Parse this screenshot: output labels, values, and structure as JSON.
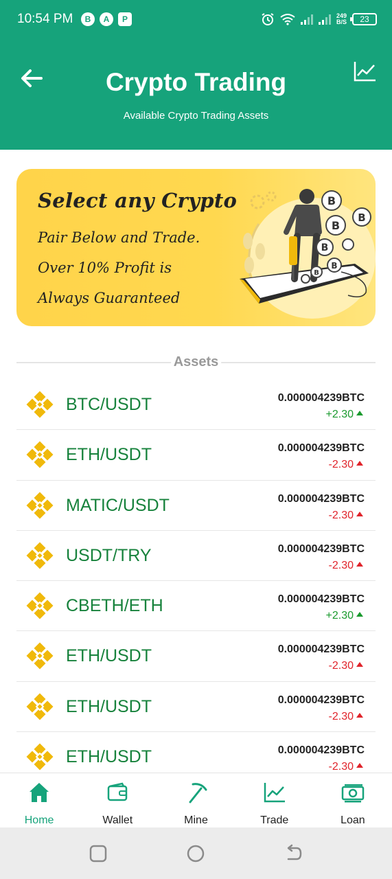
{
  "status_bar": {
    "time": "10:54 PM",
    "notif_icons": [
      "B",
      "A",
      "P"
    ],
    "net_speed_value": "249",
    "net_speed_unit": "B/S",
    "battery": "23"
  },
  "header": {
    "title": "Crypto Trading",
    "subtitle": "Available Crypto Trading Assets",
    "bg_color": "#16a37b"
  },
  "banner": {
    "headline": "Select any Crypto",
    "line1": "Pair Below and Trade.",
    "line2": "Over 10% Profit is",
    "line3": "Always Guaranteed"
  },
  "assets_label": "Assets",
  "assets": [
    {
      "pair": "BTC/USDT",
      "price": "0.000004239BTC",
      "change": "+2.30",
      "direction": "up"
    },
    {
      "pair": "ETH/USDT",
      "price": "0.000004239BTC",
      "change": "-2.30",
      "direction": "down"
    },
    {
      "pair": "MATIC/USDT",
      "price": "0.000004239BTC",
      "change": "-2.30",
      "direction": "down"
    },
    {
      "pair": "USDT/TRY",
      "price": "0.000004239BTC",
      "change": "-2.30",
      "direction": "down"
    },
    {
      "pair": "CBETH/ETH",
      "price": "0.000004239BTC",
      "change": "+2.30",
      "direction": "up"
    },
    {
      "pair": "ETH/USDT",
      "price": "0.000004239BTC",
      "change": "-2.30",
      "direction": "down"
    },
    {
      "pair": "ETH/USDT",
      "price": "0.000004239BTC",
      "change": "-2.30",
      "direction": "down"
    },
    {
      "pair": "ETH/USDT",
      "price": "0.000004239BTC",
      "change": "-2.30",
      "direction": "down"
    }
  ],
  "nav": [
    {
      "label": "Home",
      "icon": "home-icon",
      "active": true
    },
    {
      "label": "Wallet",
      "icon": "wallet-icon",
      "active": false
    },
    {
      "label": "Mine",
      "icon": "pickaxe-icon",
      "active": false
    },
    {
      "label": "Trade",
      "icon": "chart-line-icon",
      "active": false
    },
    {
      "label": "Loan",
      "icon": "banknote-icon",
      "active": false
    }
  ],
  "colors": {
    "accent": "#16a37b",
    "pair_text": "#17823c",
    "positive": "#1a9a2e",
    "negative": "#e0242b",
    "banner": "#ffd84f",
    "coin_logo": "#f0b90b"
  }
}
